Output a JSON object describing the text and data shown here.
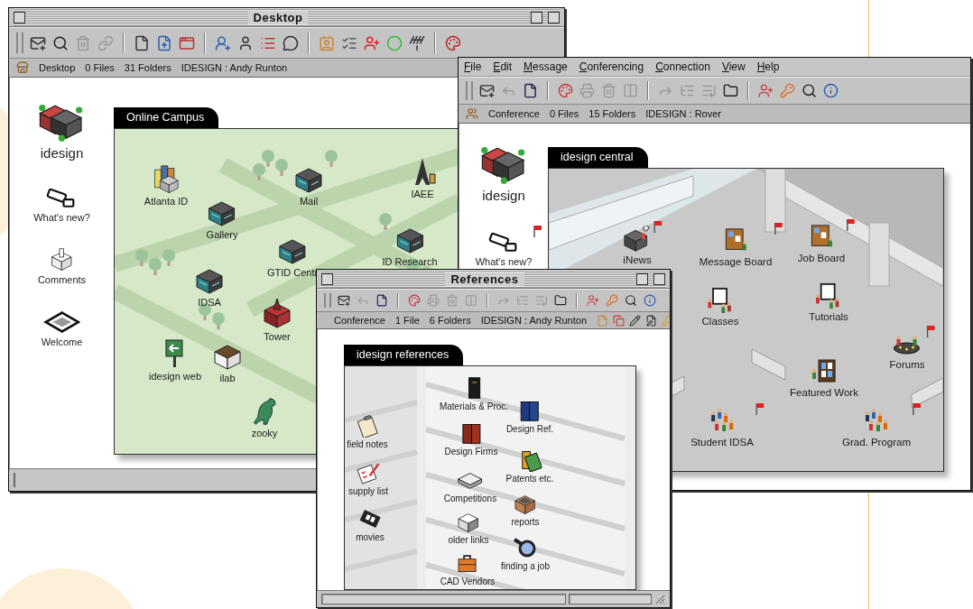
{
  "desktop_window": {
    "title": "Desktop",
    "status": {
      "location": "Desktop",
      "files": "0 Files",
      "folders": "31 Folders",
      "user": "IDESIGN : Andy Runton"
    },
    "sidebar": [
      {
        "label": "idesign",
        "kind": "campus"
      },
      {
        "label": "What's new?",
        "kind": "cards"
      },
      {
        "label": "Comments",
        "kind": "ballot"
      },
      {
        "label": "Welcome",
        "kind": "mat"
      }
    ],
    "panel": {
      "tab": "Online Campus",
      "items": [
        {
          "label": "Atlanta ID",
          "kind": "skyscrapers"
        },
        {
          "label": "Gallery",
          "kind": "building"
        },
        {
          "label": "Mail",
          "kind": "building"
        },
        {
          "label": "IAEE",
          "kind": "tower"
        },
        {
          "label": "GTID Centr",
          "kind": "building"
        },
        {
          "label": "ID Research",
          "kind": "building"
        },
        {
          "label": "IDSA",
          "kind": "building"
        },
        {
          "label": "Tower",
          "kind": "church"
        },
        {
          "label": "idesign web",
          "kind": "sign"
        },
        {
          "label": "ilab",
          "kind": "house"
        },
        {
          "label": "zooky",
          "kind": "dinosaur"
        }
      ]
    }
  },
  "conference_window": {
    "menu": [
      "File",
      "Edit",
      "Message",
      "Conferencing",
      "Connection",
      "View",
      "Help"
    ],
    "status": {
      "location": "Conference",
      "files": "0 Files",
      "folders": "15 Folders",
      "user": "IDESIGN : Rover"
    },
    "sidebar": [
      {
        "label": "idesign",
        "kind": "campus",
        "flagged": false
      },
      {
        "label": "What's new?",
        "kind": "cards",
        "flagged": true
      }
    ],
    "panel": {
      "tab": "idesign central",
      "items": [
        {
          "label": "iNews",
          "kind": "reporter",
          "flagged": true
        },
        {
          "label": "Message Board",
          "kind": "board",
          "flagged": true
        },
        {
          "label": "Job Board",
          "kind": "board",
          "flagged": true
        },
        {
          "label": "Classes",
          "kind": "whiteboard",
          "flagged": false
        },
        {
          "label": "Tutorials",
          "kind": "whiteboard",
          "flagged": false
        },
        {
          "label": "Forums",
          "kind": "round-table",
          "flagged": true
        },
        {
          "label": "Featured Work",
          "kind": "frame",
          "flagged": false
        },
        {
          "label": "Student IDSA",
          "kind": "people",
          "flagged": true
        },
        {
          "label": "Grad. Program",
          "kind": "people",
          "flagged": true
        }
      ]
    }
  },
  "references_window": {
    "title": "References",
    "status": {
      "location": "Conference",
      "files": "1 File",
      "folders": "6 Folders",
      "user": "IDESIGN : Andy Runton"
    },
    "panel": {
      "tab": "idesign references",
      "items": [
        {
          "label": "field notes",
          "kind": "clipboard"
        },
        {
          "label": "supply list",
          "kind": "checklist"
        },
        {
          "label": "movies",
          "kind": "film"
        },
        {
          "label": "Materials & Proc.",
          "kind": "book"
        },
        {
          "label": "Design Ref.",
          "kind": "books"
        },
        {
          "label": "Design Firms",
          "kind": "binders"
        },
        {
          "label": "Patents etc.",
          "kind": "green-book"
        },
        {
          "label": "Competitions",
          "kind": "papers"
        },
        {
          "label": "reports",
          "kind": "crate"
        },
        {
          "label": "older links",
          "kind": "box"
        },
        {
          "label": "finding a job",
          "kind": "magnifier"
        },
        {
          "label": "CAD Vendors",
          "kind": "toolbox"
        }
      ]
    }
  }
}
